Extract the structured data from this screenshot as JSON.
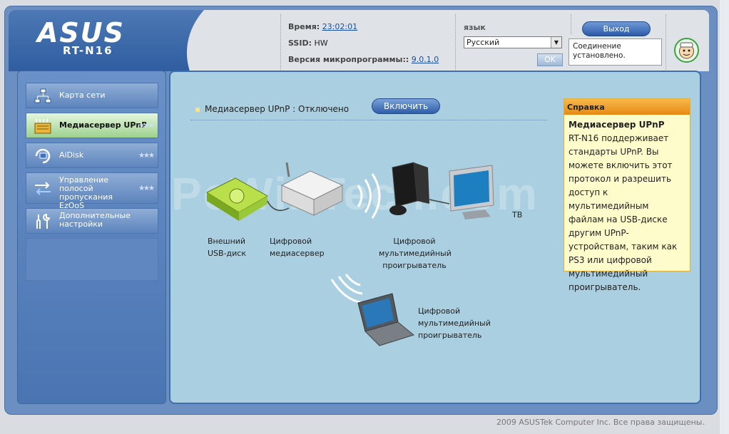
{
  "header": {
    "brand": "ASUS",
    "model": "RT-N16",
    "time_label": "Время:",
    "time_value": "23:02:01",
    "ssid_label": "SSID:",
    "ssid_value": "HW",
    "firmware_label": "Версия микропрограммы::",
    "firmware_value": "9.0.1.0",
    "language_label": "язык",
    "language_selected": "Русский",
    "ok_label": "OK",
    "exit_label": "Выход",
    "status_text": "Соединение установлено."
  },
  "sidebar": {
    "items": [
      {
        "label": "Карта сети"
      },
      {
        "label": "Медиасервер UPnP"
      },
      {
        "label": "AiDisk"
      },
      {
        "label": "Управление полосой пропускания EzQoS"
      },
      {
        "label": "Дополнительные настройки"
      }
    ]
  },
  "main": {
    "title": "Медиасервер UPnP : Отключено",
    "enable_label": "Включить",
    "labels": {
      "usb_disk": "Внешний USB-диск",
      "media_server": "Цифровой медиасервер",
      "player1": "Цифровой мультимедийный проигрыватель",
      "tv": "ТВ",
      "player2": "Цифровой мультимедийный проигрыватель"
    },
    "watermark": "PcWinTech.com"
  },
  "help": {
    "title": "Справка",
    "heading": "Медиасервер UPnP",
    "text": "RT-N16 поддерживает стандарты UPnP. Вы можете включить этот протокол и разрешить доступ к мультимедийным файлам на USB-диске другим UPnP-устройствам, таким как PS3 или цифровой мультимедийный проигрыватель."
  },
  "footer": {
    "copyright": "2009 ASUSTek Computer Inc. Все права защищены."
  }
}
